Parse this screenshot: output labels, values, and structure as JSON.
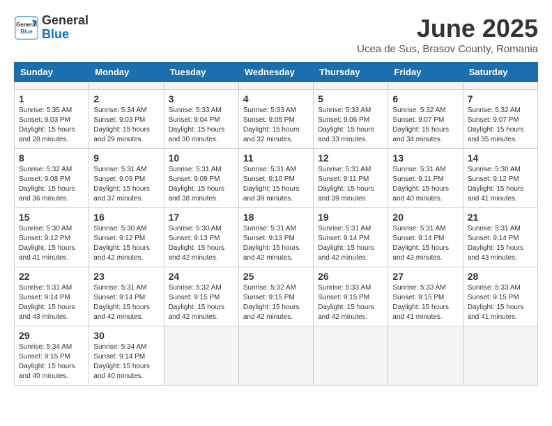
{
  "header": {
    "logo_general": "General",
    "logo_blue": "Blue",
    "month_title": "June 2025",
    "location": "Ucea de Sus, Brasov County, Romania"
  },
  "calendar": {
    "days_of_week": [
      "Sunday",
      "Monday",
      "Tuesday",
      "Wednesday",
      "Thursday",
      "Friday",
      "Saturday"
    ],
    "weeks": [
      [
        {
          "day": "",
          "empty": true
        },
        {
          "day": "",
          "empty": true
        },
        {
          "day": "",
          "empty": true
        },
        {
          "day": "",
          "empty": true
        },
        {
          "day": "",
          "empty": true
        },
        {
          "day": "",
          "empty": true
        },
        {
          "day": "",
          "empty": true
        }
      ],
      [
        {
          "num": "1",
          "sunrise": "Sunrise: 5:35 AM",
          "sunset": "Sunset: 9:03 PM",
          "daylight": "Daylight: 15 hours and 28 minutes."
        },
        {
          "num": "2",
          "sunrise": "Sunrise: 5:34 AM",
          "sunset": "Sunset: 9:03 PM",
          "daylight": "Daylight: 15 hours and 29 minutes."
        },
        {
          "num": "3",
          "sunrise": "Sunrise: 5:33 AM",
          "sunset": "Sunset: 9:04 PM",
          "daylight": "Daylight: 15 hours and 30 minutes."
        },
        {
          "num": "4",
          "sunrise": "Sunrise: 5:33 AM",
          "sunset": "Sunset: 9:05 PM",
          "daylight": "Daylight: 15 hours and 32 minutes."
        },
        {
          "num": "5",
          "sunrise": "Sunrise: 5:33 AM",
          "sunset": "Sunset: 9:06 PM",
          "daylight": "Daylight: 15 hours and 33 minutes."
        },
        {
          "num": "6",
          "sunrise": "Sunrise: 5:32 AM",
          "sunset": "Sunset: 9:07 PM",
          "daylight": "Daylight: 15 hours and 34 minutes."
        },
        {
          "num": "7",
          "sunrise": "Sunrise: 5:32 AM",
          "sunset": "Sunset: 9:07 PM",
          "daylight": "Daylight: 15 hours and 35 minutes."
        }
      ],
      [
        {
          "num": "8",
          "sunrise": "Sunrise: 5:32 AM",
          "sunset": "Sunset: 9:08 PM",
          "daylight": "Daylight: 15 hours and 36 minutes."
        },
        {
          "num": "9",
          "sunrise": "Sunrise: 5:31 AM",
          "sunset": "Sunset: 9:09 PM",
          "daylight": "Daylight: 15 hours and 37 minutes."
        },
        {
          "num": "10",
          "sunrise": "Sunrise: 5:31 AM",
          "sunset": "Sunset: 9:09 PM",
          "daylight": "Daylight: 15 hours and 38 minutes."
        },
        {
          "num": "11",
          "sunrise": "Sunrise: 5:31 AM",
          "sunset": "Sunset: 9:10 PM",
          "daylight": "Daylight: 15 hours and 39 minutes."
        },
        {
          "num": "12",
          "sunrise": "Sunrise: 5:31 AM",
          "sunset": "Sunset: 9:11 PM",
          "daylight": "Daylight: 15 hours and 39 minutes."
        },
        {
          "num": "13",
          "sunrise": "Sunrise: 5:31 AM",
          "sunset": "Sunset: 9:11 PM",
          "daylight": "Daylight: 15 hours and 40 minutes."
        },
        {
          "num": "14",
          "sunrise": "Sunrise: 5:30 AM",
          "sunset": "Sunset: 9:12 PM",
          "daylight": "Daylight: 15 hours and 41 minutes."
        }
      ],
      [
        {
          "num": "15",
          "sunrise": "Sunrise: 5:30 AM",
          "sunset": "Sunset: 9:12 PM",
          "daylight": "Daylight: 15 hours and 41 minutes."
        },
        {
          "num": "16",
          "sunrise": "Sunrise: 5:30 AM",
          "sunset": "Sunset: 9:12 PM",
          "daylight": "Daylight: 15 hours and 42 minutes."
        },
        {
          "num": "17",
          "sunrise": "Sunrise: 5:30 AM",
          "sunset": "Sunset: 9:13 PM",
          "daylight": "Daylight: 15 hours and 42 minutes."
        },
        {
          "num": "18",
          "sunrise": "Sunrise: 5:31 AM",
          "sunset": "Sunset: 9:13 PM",
          "daylight": "Daylight: 15 hours and 42 minutes."
        },
        {
          "num": "19",
          "sunrise": "Sunrise: 5:31 AM",
          "sunset": "Sunset: 9:14 PM",
          "daylight": "Daylight: 15 hours and 42 minutes."
        },
        {
          "num": "20",
          "sunrise": "Sunrise: 5:31 AM",
          "sunset": "Sunset: 9:14 PM",
          "daylight": "Daylight: 15 hours and 43 minutes."
        },
        {
          "num": "21",
          "sunrise": "Sunrise: 5:31 AM",
          "sunset": "Sunset: 9:14 PM",
          "daylight": "Daylight: 15 hours and 43 minutes."
        }
      ],
      [
        {
          "num": "22",
          "sunrise": "Sunrise: 5:31 AM",
          "sunset": "Sunset: 9:14 PM",
          "daylight": "Daylight: 15 hours and 43 minutes."
        },
        {
          "num": "23",
          "sunrise": "Sunrise: 5:31 AM",
          "sunset": "Sunset: 9:14 PM",
          "daylight": "Daylight: 15 hours and 42 minutes."
        },
        {
          "num": "24",
          "sunrise": "Sunrise: 5:32 AM",
          "sunset": "Sunset: 9:15 PM",
          "daylight": "Daylight: 15 hours and 42 minutes."
        },
        {
          "num": "25",
          "sunrise": "Sunrise: 5:32 AM",
          "sunset": "Sunset: 9:15 PM",
          "daylight": "Daylight: 15 hours and 42 minutes."
        },
        {
          "num": "26",
          "sunrise": "Sunrise: 5:33 AM",
          "sunset": "Sunset: 9:15 PM",
          "daylight": "Daylight: 15 hours and 42 minutes."
        },
        {
          "num": "27",
          "sunrise": "Sunrise: 5:33 AM",
          "sunset": "Sunset: 9:15 PM",
          "daylight": "Daylight: 15 hours and 41 minutes."
        },
        {
          "num": "28",
          "sunrise": "Sunrise: 5:33 AM",
          "sunset": "Sunset: 9:15 PM",
          "daylight": "Daylight: 15 hours and 41 minutes."
        }
      ],
      [
        {
          "num": "29",
          "sunrise": "Sunrise: 5:34 AM",
          "sunset": "Sunset: 9:15 PM",
          "daylight": "Daylight: 15 hours and 40 minutes."
        },
        {
          "num": "30",
          "sunrise": "Sunrise: 5:34 AM",
          "sunset": "Sunset: 9:14 PM",
          "daylight": "Daylight: 15 hours and 40 minutes."
        },
        {
          "day": "",
          "empty": true
        },
        {
          "day": "",
          "empty": true
        },
        {
          "day": "",
          "empty": true
        },
        {
          "day": "",
          "empty": true
        },
        {
          "day": "",
          "empty": true
        }
      ]
    ]
  }
}
